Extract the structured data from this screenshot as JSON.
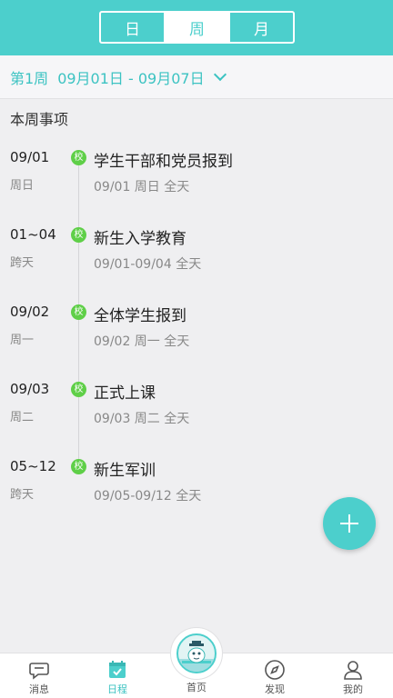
{
  "header": {
    "segments": [
      {
        "label": "日",
        "active": false
      },
      {
        "label": "周",
        "active": true
      },
      {
        "label": "月",
        "active": false
      }
    ]
  },
  "week_selector": {
    "week": "第1周",
    "range": "09月01日 - 09月07日",
    "icon": "chevron-down-icon"
  },
  "section_title": "本周事项",
  "events": [
    {
      "date": "09/01",
      "day": "周日",
      "badge": "校",
      "title": "学生干部和党员报到",
      "time": "09/01 周日 全天"
    },
    {
      "date": "01~04",
      "day": "跨天",
      "badge": "校",
      "title": "新生入学教育",
      "time": "09/01-09/04 全天"
    },
    {
      "date": "09/02",
      "day": "周一",
      "badge": "校",
      "title": "全体学生报到",
      "time": "09/02 周一 全天"
    },
    {
      "date": "09/03",
      "day": "周二",
      "badge": "校",
      "title": "正式上课",
      "time": "09/03 周二 全天"
    },
    {
      "date": "05~12",
      "day": "跨天",
      "badge": "校",
      "title": "新生军训",
      "time": "09/05-09/12 全天"
    }
  ],
  "fab": {
    "icon": "plus-icon"
  },
  "tabbar": {
    "items": [
      {
        "label": "消息",
        "icon": "message-icon",
        "active": false
      },
      {
        "label": "日程",
        "icon": "calendar-icon",
        "active": true
      },
      {
        "label": "首页",
        "icon": "home-mascot-icon",
        "active": false
      },
      {
        "label": "发现",
        "icon": "compass-icon",
        "active": false
      },
      {
        "label": "我的",
        "icon": "user-icon",
        "active": false
      }
    ]
  },
  "colors": {
    "accent": "#4ccfcc",
    "badge": "#5fcf48",
    "background": "#efeff1"
  }
}
